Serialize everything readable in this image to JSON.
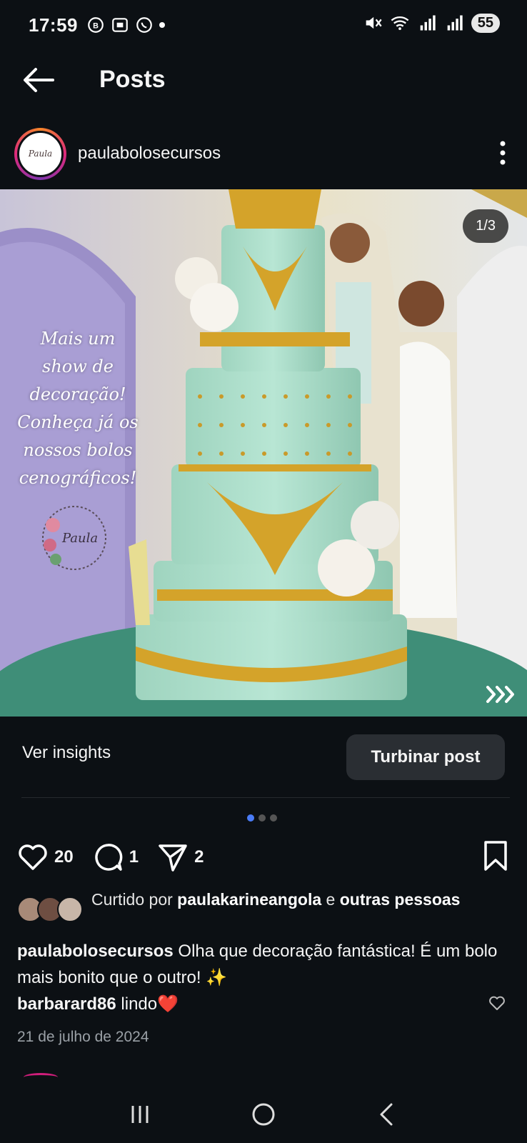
{
  "status_bar": {
    "time": "17:59",
    "battery": "55",
    "icons": [
      "whatsapp-business-icon",
      "screenshot-icon",
      "whatsapp-icon",
      "mute-icon",
      "wifi-icon",
      "signal-icon",
      "signal-icon"
    ]
  },
  "header": {
    "title": "Posts"
  },
  "post": {
    "username": "paulabolosecursos",
    "avatar_text": "Paula",
    "carousel_counter": "1/3",
    "overlay_lines": [
      "Mais um",
      "show de",
      "decoração!",
      "Conheça já os",
      "nossos bolos",
      "cenográficos!"
    ],
    "watermark_text": "Paula",
    "insights_label": "Ver insights",
    "boost_label": "Turbinar post",
    "likes_count": "20",
    "comments_count": "1",
    "shares_count": "2",
    "liked_by_prefix": "Curtido por ",
    "liked_by_user": "paulakarineangola",
    "liked_by_mid": " e ",
    "liked_by_rest": "outras pessoas",
    "caption_user": "paulabolosecursos",
    "caption_text": " Olha que decoração fantástica! É um bolo mais bonito que o outro! ✨",
    "comment_user": "barbarard86",
    "comment_text": " lindo❤️",
    "date": "21 de julho de 2024"
  },
  "colors": {
    "background": "#0c1014",
    "accent_blue": "#4a7cf7",
    "boost_bg": "#2a2e33",
    "cake_mint": "#a9dcc8",
    "gold": "#d4a32a"
  }
}
